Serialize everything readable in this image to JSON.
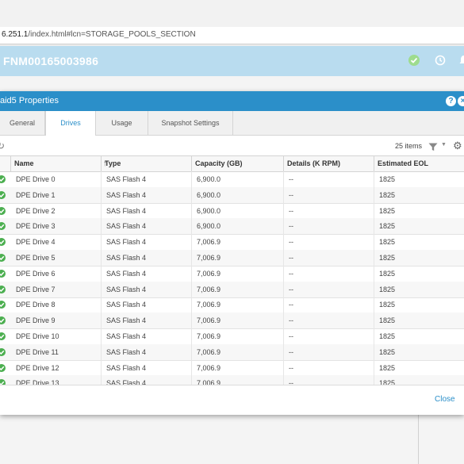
{
  "browser": {
    "url_host": "6.251.1",
    "url_path": "/index.html#lcn=STORAGE_POOLS_SECTION"
  },
  "header": {
    "system_name": "FNM00165003986",
    "icons": [
      "health-ok-icon",
      "history-icon",
      "notifications-icon"
    ]
  },
  "dialog": {
    "title": "aid5 Properties",
    "help_label": "?",
    "close_x_label": "×",
    "tabs": [
      {
        "label": "General",
        "active": false
      },
      {
        "label": "Drives",
        "active": true
      },
      {
        "label": "Usage",
        "active": false
      },
      {
        "label": "Snapshot Settings",
        "active": false
      }
    ],
    "toolbar": {
      "items_count": "25 items",
      "icons": [
        "refresh-icon",
        "filter-icon",
        "gear-icon"
      ]
    },
    "grid": {
      "columns": [
        "Name",
        "Type",
        "Capacity (GB)",
        "Details (K RPM)",
        "Estimated EOL"
      ],
      "rows": [
        {
          "name": "DPE Drive 0",
          "type": "SAS Flash 4",
          "capacity": "6,900.0",
          "details": "--",
          "eol": "1825"
        },
        {
          "name": "DPE Drive 1",
          "type": "SAS Flash 4",
          "capacity": "6,900.0",
          "details": "--",
          "eol": "1825"
        },
        {
          "name": "DPE Drive 2",
          "type": "SAS Flash 4",
          "capacity": "6,900.0",
          "details": "--",
          "eol": "1825"
        },
        {
          "name": "DPE Drive 3",
          "type": "SAS Flash 4",
          "capacity": "6,900.0",
          "details": "--",
          "eol": "1825"
        },
        {
          "name": "DPE Drive 4",
          "type": "SAS Flash 4",
          "capacity": "7,006.9",
          "details": "--",
          "eol": "1825"
        },
        {
          "name": "DPE Drive 5",
          "type": "SAS Flash 4",
          "capacity": "7,006.9",
          "details": "--",
          "eol": "1825"
        },
        {
          "name": "DPE Drive 6",
          "type": "SAS Flash 4",
          "capacity": "7,006.9",
          "details": "--",
          "eol": "1825"
        },
        {
          "name": "DPE Drive 7",
          "type": "SAS Flash 4",
          "capacity": "7,006.9",
          "details": "--",
          "eol": "1825"
        },
        {
          "name": "DPE Drive 8",
          "type": "SAS Flash 4",
          "capacity": "7,006.9",
          "details": "--",
          "eol": "1825"
        },
        {
          "name": "DPE Drive 9",
          "type": "SAS Flash 4",
          "capacity": "7,006.9",
          "details": "--",
          "eol": "1825"
        },
        {
          "name": "DPE Drive 10",
          "type": "SAS Flash 4",
          "capacity": "7,006.9",
          "details": "--",
          "eol": "1825"
        },
        {
          "name": "DPE Drive 11",
          "type": "SAS Flash 4",
          "capacity": "7,006.9",
          "details": "--",
          "eol": "1825"
        },
        {
          "name": "DPE Drive 12",
          "type": "SAS Flash 4",
          "capacity": "7,006.9",
          "details": "--",
          "eol": "1825"
        },
        {
          "name": "DPE Drive 13",
          "type": "SAS Flash 4",
          "capacity": "7,006.9",
          "details": "--",
          "eol": "1825"
        }
      ]
    },
    "footer": {
      "close_label": "Close"
    }
  },
  "colors": {
    "accent": "#2b8fc9",
    "header_bg": "#b9dcef",
    "status_ok": "#4caf50"
  }
}
